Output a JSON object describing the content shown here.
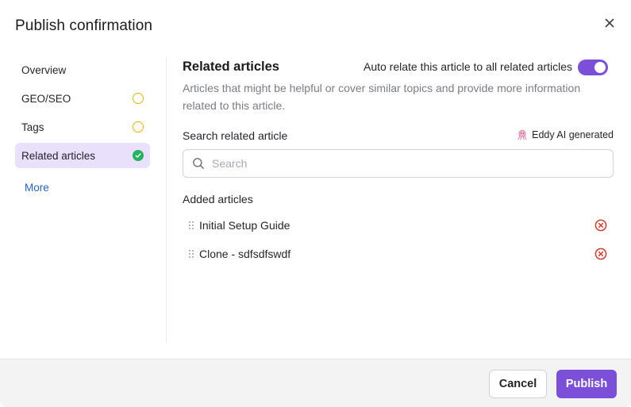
{
  "dialog": {
    "title": "Publish confirmation"
  },
  "nav": {
    "items": [
      {
        "label": "Overview",
        "status": "none"
      },
      {
        "label": "GEO/SEO",
        "status": "pending"
      },
      {
        "label": "Tags",
        "status": "pending"
      },
      {
        "label": "Related articles",
        "status": "done",
        "active": true
      }
    ],
    "more_label": "More"
  },
  "related": {
    "title": "Related articles",
    "auto_relate_label": "Auto relate this article to all related articles",
    "auto_relate_enabled": true,
    "description": "Articles that might be helpful or cover similar topics and provide more information related to this article.",
    "search_label": "Search related article",
    "ai_badge": "Eddy AI generated",
    "search_placeholder": "Search",
    "search_value": "",
    "added_label": "Added articles",
    "articles": [
      {
        "name": "Initial Setup Guide"
      },
      {
        "name": "Clone - sdfsdfswdf"
      }
    ]
  },
  "footer": {
    "cancel_label": "Cancel",
    "publish_label": "Publish"
  },
  "colors": {
    "accent": "#7b4fd8",
    "active_nav_bg": "#e9e0fb",
    "pending": "#f0b400",
    "done": "#22b35e",
    "remove": "#d23b2f",
    "link": "#2563c9"
  },
  "icons": {
    "close": "close-icon",
    "search": "search-icon",
    "ai": "octopus-icon",
    "drag": "drag-handle-icon",
    "remove": "remove-circle-icon",
    "done": "check-circle-icon",
    "pending": "pending-circle-icon"
  }
}
